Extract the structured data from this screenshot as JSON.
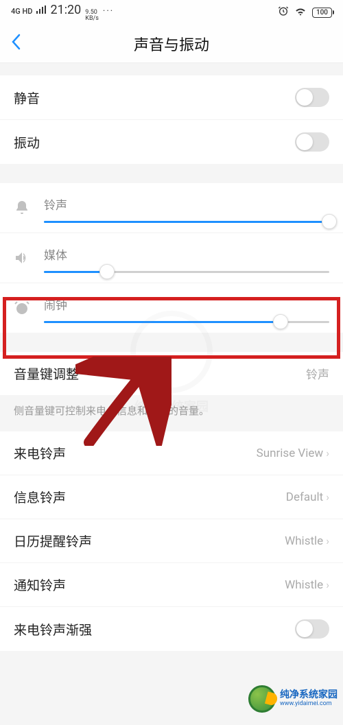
{
  "status_bar": {
    "network": "4G HD",
    "time": "21:20",
    "speed_value": "9.50",
    "speed_unit": "KB/s",
    "dots": "···",
    "battery": "100"
  },
  "header": {
    "title": "声音与振动"
  },
  "toggles": {
    "mute_label": "静音",
    "vibrate_label": "振动"
  },
  "sliders": {
    "ringtone": {
      "label": "铃声",
      "value_pct": 100
    },
    "media": {
      "label": "媒体",
      "value_pct": 22
    },
    "alarm": {
      "label": "闹钟",
      "value_pct": 83
    }
  },
  "volume_key": {
    "label": "音量键调整",
    "value": "铃声",
    "help": "侧音量键可控制来电、信息和通知的音量。"
  },
  "ringtones": {
    "incoming": {
      "label": "来电铃声",
      "value": "Sunrise View"
    },
    "message": {
      "label": "信息铃声",
      "value": "Default"
    },
    "calendar": {
      "label": "日历提醒铃声",
      "value": "Whistle"
    },
    "notification": {
      "label": "通知铃声",
      "value": "Whistle"
    },
    "crescendo": {
      "label": "来电铃声渐强"
    }
  },
  "watermark": {
    "brand": "纯净系统家园",
    "url": "www.yidaimei.com"
  }
}
